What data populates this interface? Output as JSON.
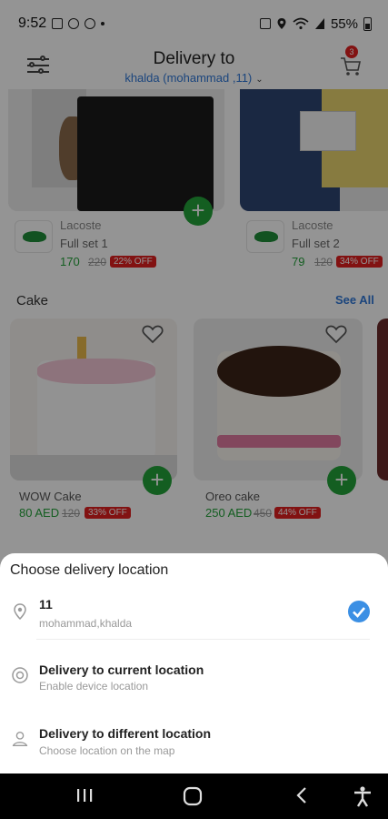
{
  "status_bar": {
    "time": "9:52",
    "battery": "55%"
  },
  "header": {
    "title": "Delivery to",
    "subtitle": "khalda (mohammad ,11)",
    "cart_count": "3"
  },
  "products_top": [
    {
      "brand": "Lacoste",
      "name": "Full set 1",
      "price": "170",
      "old_price": "220",
      "discount": "22% OFF"
    },
    {
      "brand": "Lacoste",
      "name": "Full set 2",
      "price": "79",
      "old_price": "120",
      "discount": "34% OFF"
    }
  ],
  "section": {
    "title": "Cake",
    "see_all": "See All"
  },
  "cakes": [
    {
      "name": "WOW Cake",
      "price": "80 AED",
      "old_price": "120",
      "discount": "33% OFF"
    },
    {
      "name": "Oreo cake",
      "price": "250 AED",
      "old_price": "450",
      "discount": "44% OFF"
    }
  ],
  "sheet": {
    "title": "Choose delivery location",
    "options": [
      {
        "title": "11",
        "subtitle": "mohammad,khalda"
      },
      {
        "title": "Delivery to current location",
        "subtitle": "Enable device location"
      },
      {
        "title": "Delivery to different location",
        "subtitle": "Choose location on the map"
      }
    ]
  },
  "colors": {
    "accent": "#2f78d8",
    "add": "#23a23a",
    "discount": "#e02020",
    "check": "#3b8fe4"
  },
  "icons": [
    "filter-icon",
    "cart-icon",
    "plus-icon",
    "heart-icon",
    "location-pin-icon",
    "gps-icon",
    "person-pin-icon",
    "check-icon"
  ]
}
